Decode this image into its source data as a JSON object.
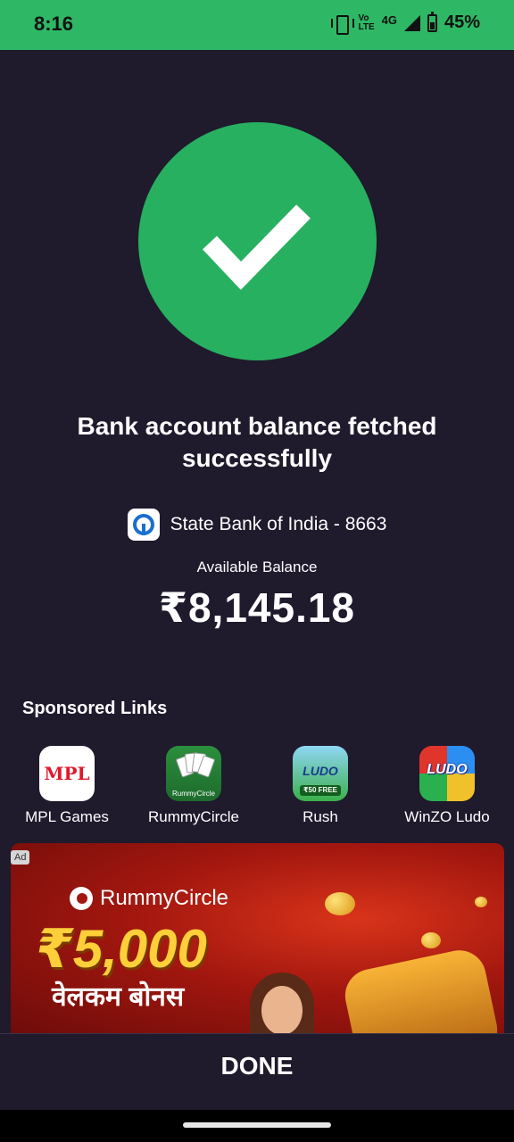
{
  "status_bar": {
    "time": "8:16",
    "volte_top": "Vo",
    "volte_bottom": "LTE",
    "network": "4G",
    "battery_percent": "45%",
    "icons": [
      "vibrate-icon",
      "volte-icon",
      "signal-icon",
      "battery-charging-icon"
    ]
  },
  "result": {
    "icon": "checkmark-icon",
    "title": "Bank account balance fetched successfully",
    "bank_name": "State Bank of India - 8663",
    "balance_label": "Available Balance",
    "balance_amount": "₹8,145.18"
  },
  "sponsored": {
    "heading": "Sponsored Links",
    "apps": [
      {
        "label": "MPL Games",
        "icon_text": "MPL"
      },
      {
        "label": "RummyCircle",
        "icon_text": "RummyCircle"
      },
      {
        "label": "Rush",
        "icon_text": "LUDO",
        "badge": "₹50 FREE"
      },
      {
        "label": "WinZO Ludo",
        "icon_text": "LUDO"
      }
    ]
  },
  "ad": {
    "badge": "Ad",
    "brand": "RummyCircle",
    "amount": "₹5,000",
    "hindi_text": "वेलकम बोनस"
  },
  "footer": {
    "done_label": "DONE"
  },
  "colors": {
    "accent_green": "#27b060",
    "status_green": "#2eb865",
    "background": "#1f1a2c"
  }
}
